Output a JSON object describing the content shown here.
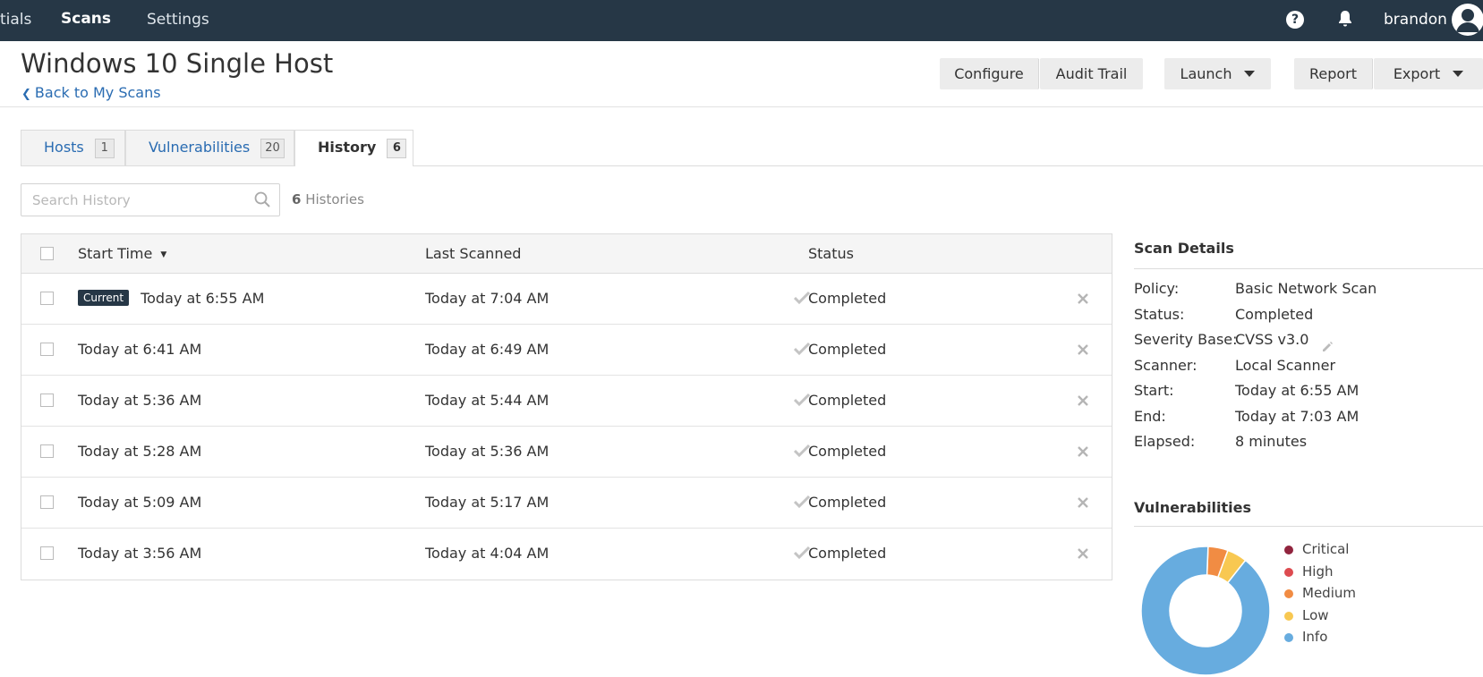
{
  "topbar": {
    "brand": "tials",
    "nav_scans": "Scans",
    "nav_settings": "Settings",
    "help_glyph": "?",
    "username": "brandon",
    "icons": [
      "help-icon",
      "bell-icon",
      "user-avatar-icon"
    ]
  },
  "header": {
    "title": "Windows 10 Single Host",
    "back_label": "Back to My Scans",
    "buttons": {
      "configure": "Configure",
      "audit_trail": "Audit Trail",
      "launch": "Launch",
      "report": "Report",
      "export": "Export"
    }
  },
  "tabs": [
    {
      "label": "Hosts",
      "count": "1"
    },
    {
      "label": "Vulnerabilities",
      "count": "20"
    },
    {
      "label": "History",
      "count": "6",
      "active": true
    }
  ],
  "search": {
    "placeholder": "Search History",
    "count": "6",
    "count_suffix": "Histories"
  },
  "table": {
    "columns": {
      "start_time": "Start Time",
      "last_scanned": "Last Scanned",
      "status": "Status"
    },
    "sort": "descending",
    "current_badge": "Current",
    "rows": [
      {
        "start": "Today at 6:55 AM",
        "last": "Today at 7:04 AM",
        "status": "Completed",
        "current": true
      },
      {
        "start": "Today at 6:41 AM",
        "last": "Today at 6:49 AM",
        "status": "Completed"
      },
      {
        "start": "Today at 5:36 AM",
        "last": "Today at 5:44 AM",
        "status": "Completed"
      },
      {
        "start": "Today at 5:28 AM",
        "last": "Today at 5:36 AM",
        "status": "Completed"
      },
      {
        "start": "Today at 5:09 AM",
        "last": "Today at 5:17 AM",
        "status": "Completed"
      },
      {
        "start": "Today at 3:56 AM",
        "last": "Today at 4:04 AM",
        "status": "Completed"
      }
    ]
  },
  "scan_details": {
    "title": "Scan Details",
    "items": [
      {
        "label": "Policy:",
        "value": "Basic Network Scan"
      },
      {
        "label": "Status:",
        "value": "Completed"
      },
      {
        "label": "Severity Base:",
        "value": "CVSS v3.0"
      },
      {
        "label": "Scanner:",
        "value": "Local Scanner"
      },
      {
        "label": "Start:",
        "value": "Today at 6:55 AM"
      },
      {
        "label": "End:",
        "value": "Today at 7:03 AM"
      },
      {
        "label": "Elapsed:",
        "value": "8 minutes"
      }
    ]
  },
  "vulnerabilities": {
    "title": "Vulnerabilities",
    "legend": [
      {
        "label": "Critical",
        "color": "#91243e"
      },
      {
        "label": "High",
        "color": "#dd4b50"
      },
      {
        "label": "Medium",
        "color": "#f18c43"
      },
      {
        "label": "Low",
        "color": "#f8c851"
      },
      {
        "label": "Info",
        "color": "#67acdf"
      }
    ]
  },
  "chart_data": {
    "type": "pie",
    "categories": [
      "Critical",
      "High",
      "Medium",
      "Low",
      "Info"
    ],
    "values": [
      0,
      0,
      1,
      1,
      18
    ],
    "colors": [
      "#91243e",
      "#dd4b50",
      "#f18c43",
      "#f8c851",
      "#67acdf"
    ]
  }
}
